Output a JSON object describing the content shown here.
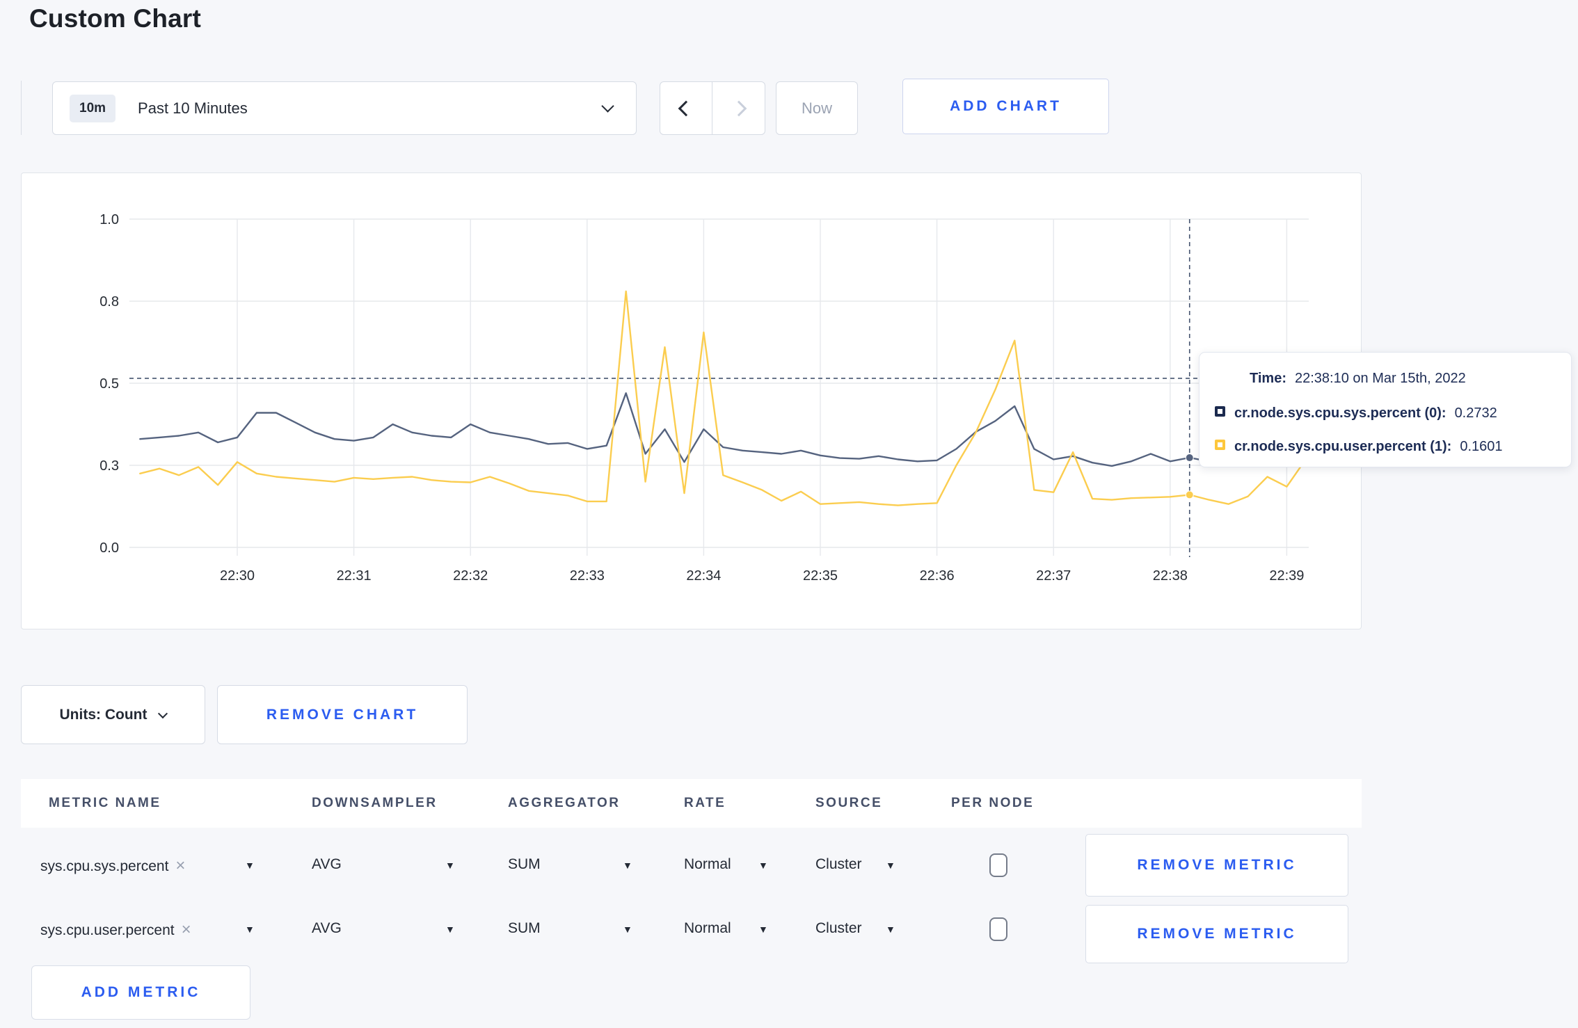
{
  "page": {
    "title": "Custom Chart"
  },
  "toolbar": {
    "time_range_badge": "10m",
    "time_range_label": "Past 10 Minutes",
    "now_label": "Now",
    "add_chart_label": "ADD CHART"
  },
  "controls": {
    "units_label": "Units: Count",
    "remove_chart_label": "REMOVE CHART",
    "add_metric_label": "ADD METRIC"
  },
  "tooltip": {
    "time_label": "Time:",
    "time_value": "22:38:10 on Mar 15th, 2022",
    "rows": [
      {
        "label": "cr.node.sys.cpu.sys.percent (0):",
        "value": "0.2732",
        "color": "#1b2a4e"
      },
      {
        "label": "cr.node.sys.cpu.user.percent (1):",
        "value": "0.1601",
        "color": "#fdc73c"
      }
    ]
  },
  "table": {
    "headers": [
      "METRIC NAME",
      "DOWNSAMPLER",
      "AGGREGATOR",
      "RATE",
      "SOURCE",
      "PER NODE"
    ],
    "rows": [
      {
        "metric": "sys.cpu.sys.percent",
        "clear": "×",
        "downsampler": "AVG",
        "aggregator": "SUM",
        "rate": "Normal",
        "source": "Cluster",
        "per_node_checked": false,
        "remove_label": "REMOVE METRIC"
      },
      {
        "metric": "sys.cpu.user.percent",
        "clear": "×",
        "downsampler": "AVG",
        "aggregator": "SUM",
        "rate": "Normal",
        "source": "Cluster",
        "per_node_checked": false,
        "remove_label": "REMOVE METRIC"
      }
    ]
  },
  "colors": {
    "accent_blue": "#2b5cf0",
    "series_sys": "#55637f",
    "series_user": "#fbcd4f",
    "grid": "#e6e8ec",
    "crosshair": "#44536e"
  },
  "chart_data": {
    "type": "line",
    "title": "",
    "xlabel": "",
    "ylabel": "",
    "ylim": [
      0,
      1
    ],
    "grid": true,
    "x_start": "22:29:10",
    "x_step_seconds": 10,
    "x": [
      "22:29:10",
      "22:29:20",
      "22:29:30",
      "22:29:40",
      "22:29:50",
      "22:30:00",
      "22:30:10",
      "22:30:20",
      "22:30:30",
      "22:30:40",
      "22:30:50",
      "22:31:00",
      "22:31:10",
      "22:31:20",
      "22:31:30",
      "22:31:40",
      "22:31:50",
      "22:32:00",
      "22:32:10",
      "22:32:20",
      "22:32:30",
      "22:32:40",
      "22:32:50",
      "22:33:00",
      "22:33:10",
      "22:33:20",
      "22:33:30",
      "22:33:40",
      "22:33:50",
      "22:34:00",
      "22:34:10",
      "22:34:20",
      "22:34:30",
      "22:34:40",
      "22:34:50",
      "22:35:00",
      "22:35:10",
      "22:35:20",
      "22:35:30",
      "22:35:40",
      "22:35:50",
      "22:36:00",
      "22:36:10",
      "22:36:20",
      "22:36:30",
      "22:36:40",
      "22:36:50",
      "22:37:00",
      "22:37:10",
      "22:37:20",
      "22:37:30",
      "22:37:40",
      "22:37:50",
      "22:38:00",
      "22:38:10",
      "22:38:20",
      "22:38:30",
      "22:38:40",
      "22:38:50",
      "22:39:00",
      "22:39:10"
    ],
    "series": [
      {
        "name": "cr.node.sys.cpu.sys.percent",
        "color": "#55637f",
        "values": [
          0.33,
          0.335,
          0.34,
          0.35,
          0.32,
          0.335,
          0.41,
          0.41,
          0.38,
          0.35,
          0.33,
          0.325,
          0.335,
          0.375,
          0.35,
          0.34,
          0.335,
          0.375,
          0.35,
          0.34,
          0.33,
          0.315,
          0.318,
          0.3,
          0.31,
          0.47,
          0.285,
          0.36,
          0.26,
          0.36,
          0.305,
          0.295,
          0.29,
          0.285,
          0.295,
          0.28,
          0.272,
          0.27,
          0.278,
          0.268,
          0.262,
          0.265,
          0.3,
          0.352,
          0.385,
          0.43,
          0.3,
          0.268,
          0.278,
          0.258,
          0.248,
          0.262,
          0.285,
          0.262,
          0.2732,
          0.262,
          0.272,
          0.29,
          0.305,
          0.295,
          0.305
        ]
      },
      {
        "name": "cr.node.sys.cpu.user.percent",
        "color": "#fbcd4f",
        "values": [
          0.225,
          0.24,
          0.22,
          0.245,
          0.19,
          0.26,
          0.225,
          0.215,
          0.21,
          0.205,
          0.2,
          0.212,
          0.208,
          0.212,
          0.215,
          0.205,
          0.2,
          0.198,
          0.215,
          0.195,
          0.172,
          0.165,
          0.158,
          0.14,
          0.14,
          0.78,
          0.2,
          0.61,
          0.165,
          0.655,
          0.22,
          0.198,
          0.175,
          0.142,
          0.17,
          0.132,
          0.135,
          0.138,
          0.132,
          0.128,
          0.132,
          0.135,
          0.25,
          0.35,
          0.48,
          0.63,
          0.175,
          0.168,
          0.29,
          0.148,
          0.145,
          0.15,
          0.152,
          0.154,
          0.1601,
          0.145,
          0.132,
          0.155,
          0.215,
          0.185,
          0.27
        ]
      }
    ],
    "yticks": [
      {
        "v": 0.0,
        "label": "0.0"
      },
      {
        "v": 0.25,
        "label": "0.3"
      },
      {
        "v": 0.5,
        "label": "0.5"
      },
      {
        "v": 0.75,
        "label": "0.8"
      },
      {
        "v": 1.0,
        "label": "1.0"
      }
    ],
    "xticks": [
      "22:30",
      "22:31",
      "22:32",
      "22:33",
      "22:34",
      "22:35",
      "22:36",
      "22:37",
      "22:38",
      "22:39"
    ],
    "crosshair": {
      "index": 54,
      "time": "22:38:10",
      "y_frac": 0.515
    },
    "legend_position": "tooltip"
  }
}
